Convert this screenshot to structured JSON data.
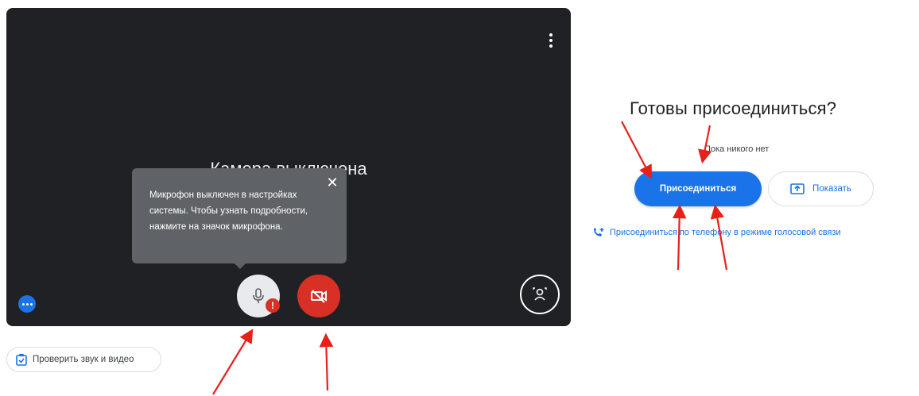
{
  "preview": {
    "camera_off_text": "Камера выключена",
    "tooltip": {
      "text": "Микрофон выключен в настройках системы. Чтобы узнать подробности, нажмите на значок микрофона.",
      "close_glyph": "✕"
    },
    "mic_alert_glyph": "!"
  },
  "check_av_label": "Проверить звук и видео",
  "join_panel": {
    "title": "Готовы присоединиться?",
    "status": "Пока никого нет",
    "join_label": "Присоединиться",
    "present_label": "Показать",
    "phone_join_label": "Присоединиться по телефону в режиме голосовой связи"
  },
  "colors": {
    "accent": "#1a73e8",
    "danger": "#d93025",
    "preview_bg": "#202124",
    "tooltip_bg": "#5f6368",
    "annotation": "#e8201a"
  }
}
